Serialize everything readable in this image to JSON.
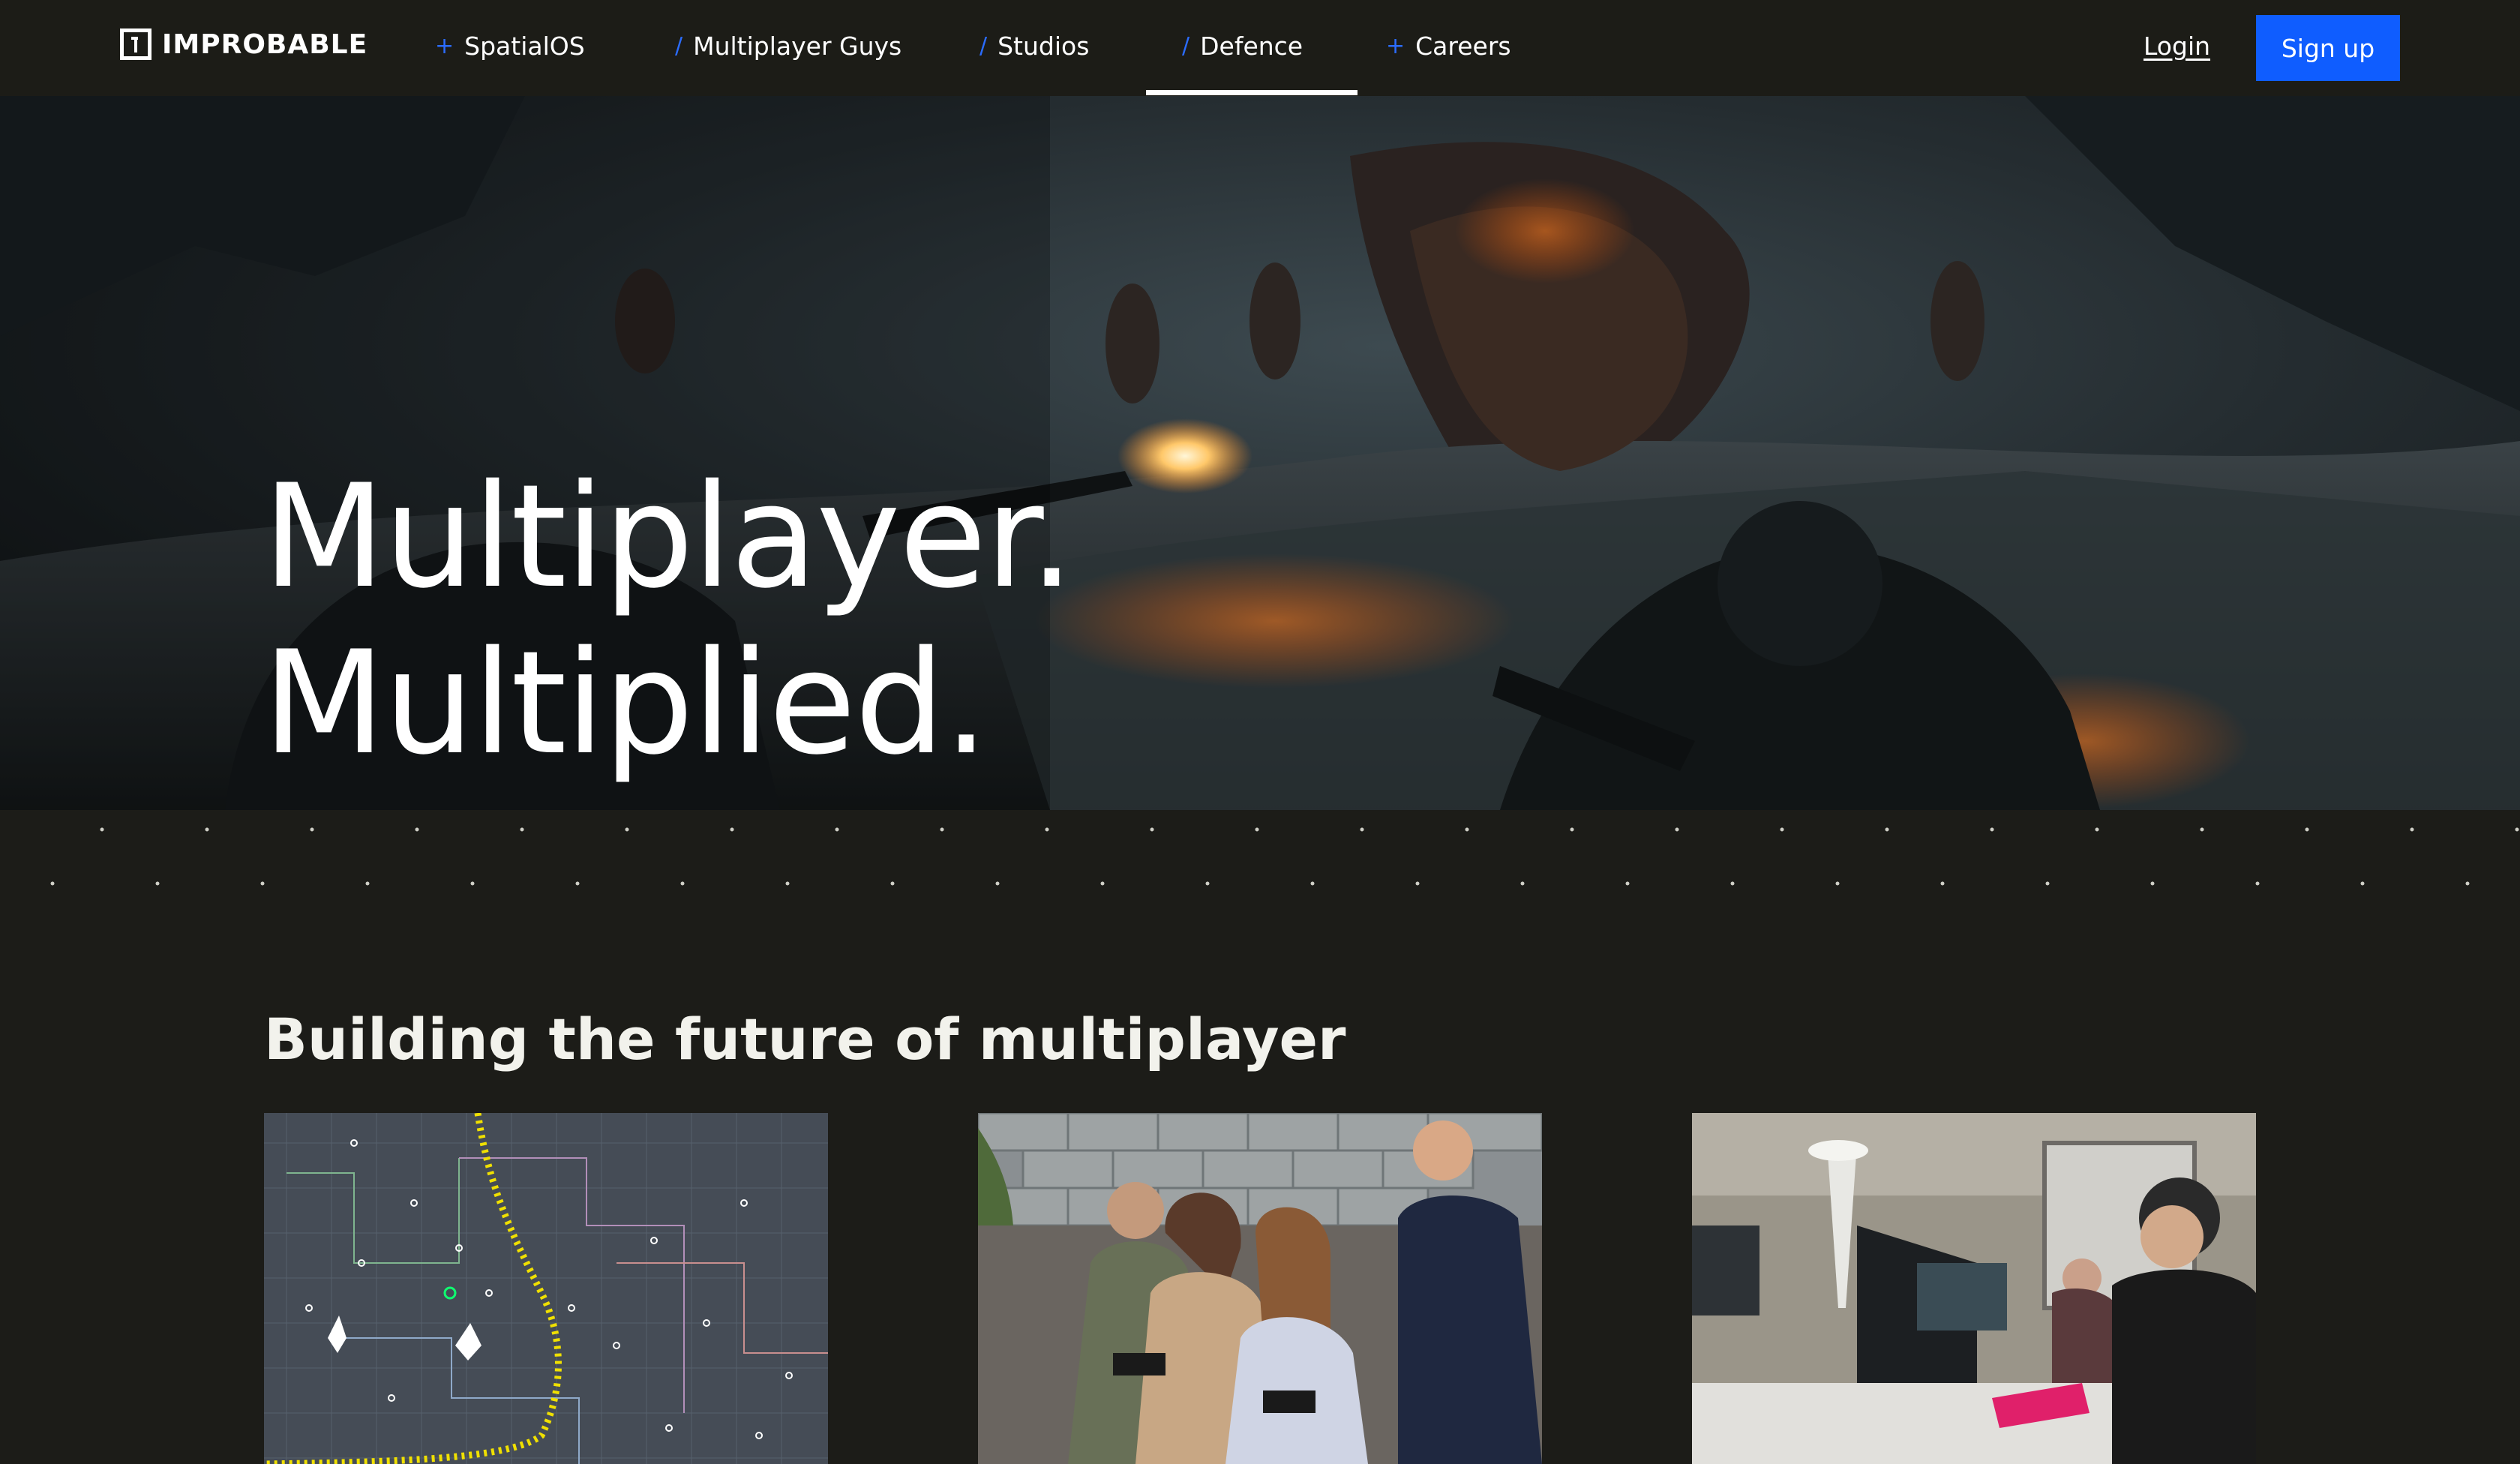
{
  "brand": {
    "name": "IMPROBABLE"
  },
  "nav": {
    "items": [
      {
        "label": "SpatialOS",
        "marker": "+"
      },
      {
        "label": "Multiplayer Guys",
        "marker": "/"
      },
      {
        "label": "Studios",
        "marker": "/"
      },
      {
        "label": "Defence",
        "marker": "/",
        "active": true
      },
      {
        "label": "Careers",
        "marker": "+"
      }
    ],
    "login": "Login",
    "signup": "Sign up"
  },
  "hero": {
    "line1": "Multiplayer.",
    "line2": "Multiplied."
  },
  "section": {
    "title": "Building the future of multiplayer"
  },
  "colors": {
    "accent": "#0f5dff",
    "nav_bg": "#1c1c17",
    "page_bg": "#1c1c18",
    "nav_marker": "#2b6cff"
  }
}
